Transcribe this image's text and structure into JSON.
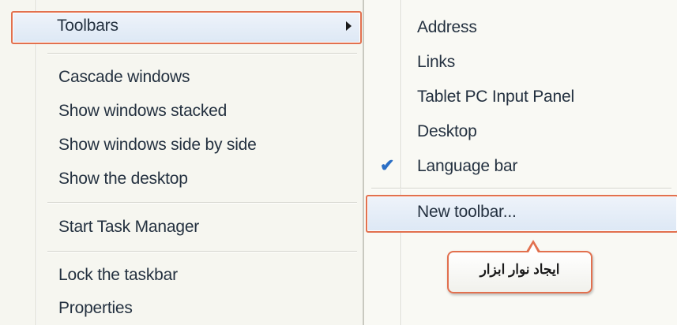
{
  "left_menu": {
    "toolbars_label": "Toolbars",
    "items": [
      "Cascade windows",
      "Show windows stacked",
      "Show windows side by side",
      "Show the desktop",
      "Start Task Manager",
      "Lock the taskbar",
      "Properties"
    ]
  },
  "toolbars_submenu": {
    "items": [
      "Address",
      "Links",
      "Tablet PC Input Panel",
      "Desktop",
      "Language bar"
    ],
    "checked_item": "Language bar",
    "new_toolbar_label": "New toolbar..."
  },
  "callout": {
    "text": "ایجاد نوار ابزار"
  },
  "colors": {
    "highlight_border": "#e2704e",
    "check": "#2b6fc5",
    "menu_background": "#f6f6f0"
  }
}
